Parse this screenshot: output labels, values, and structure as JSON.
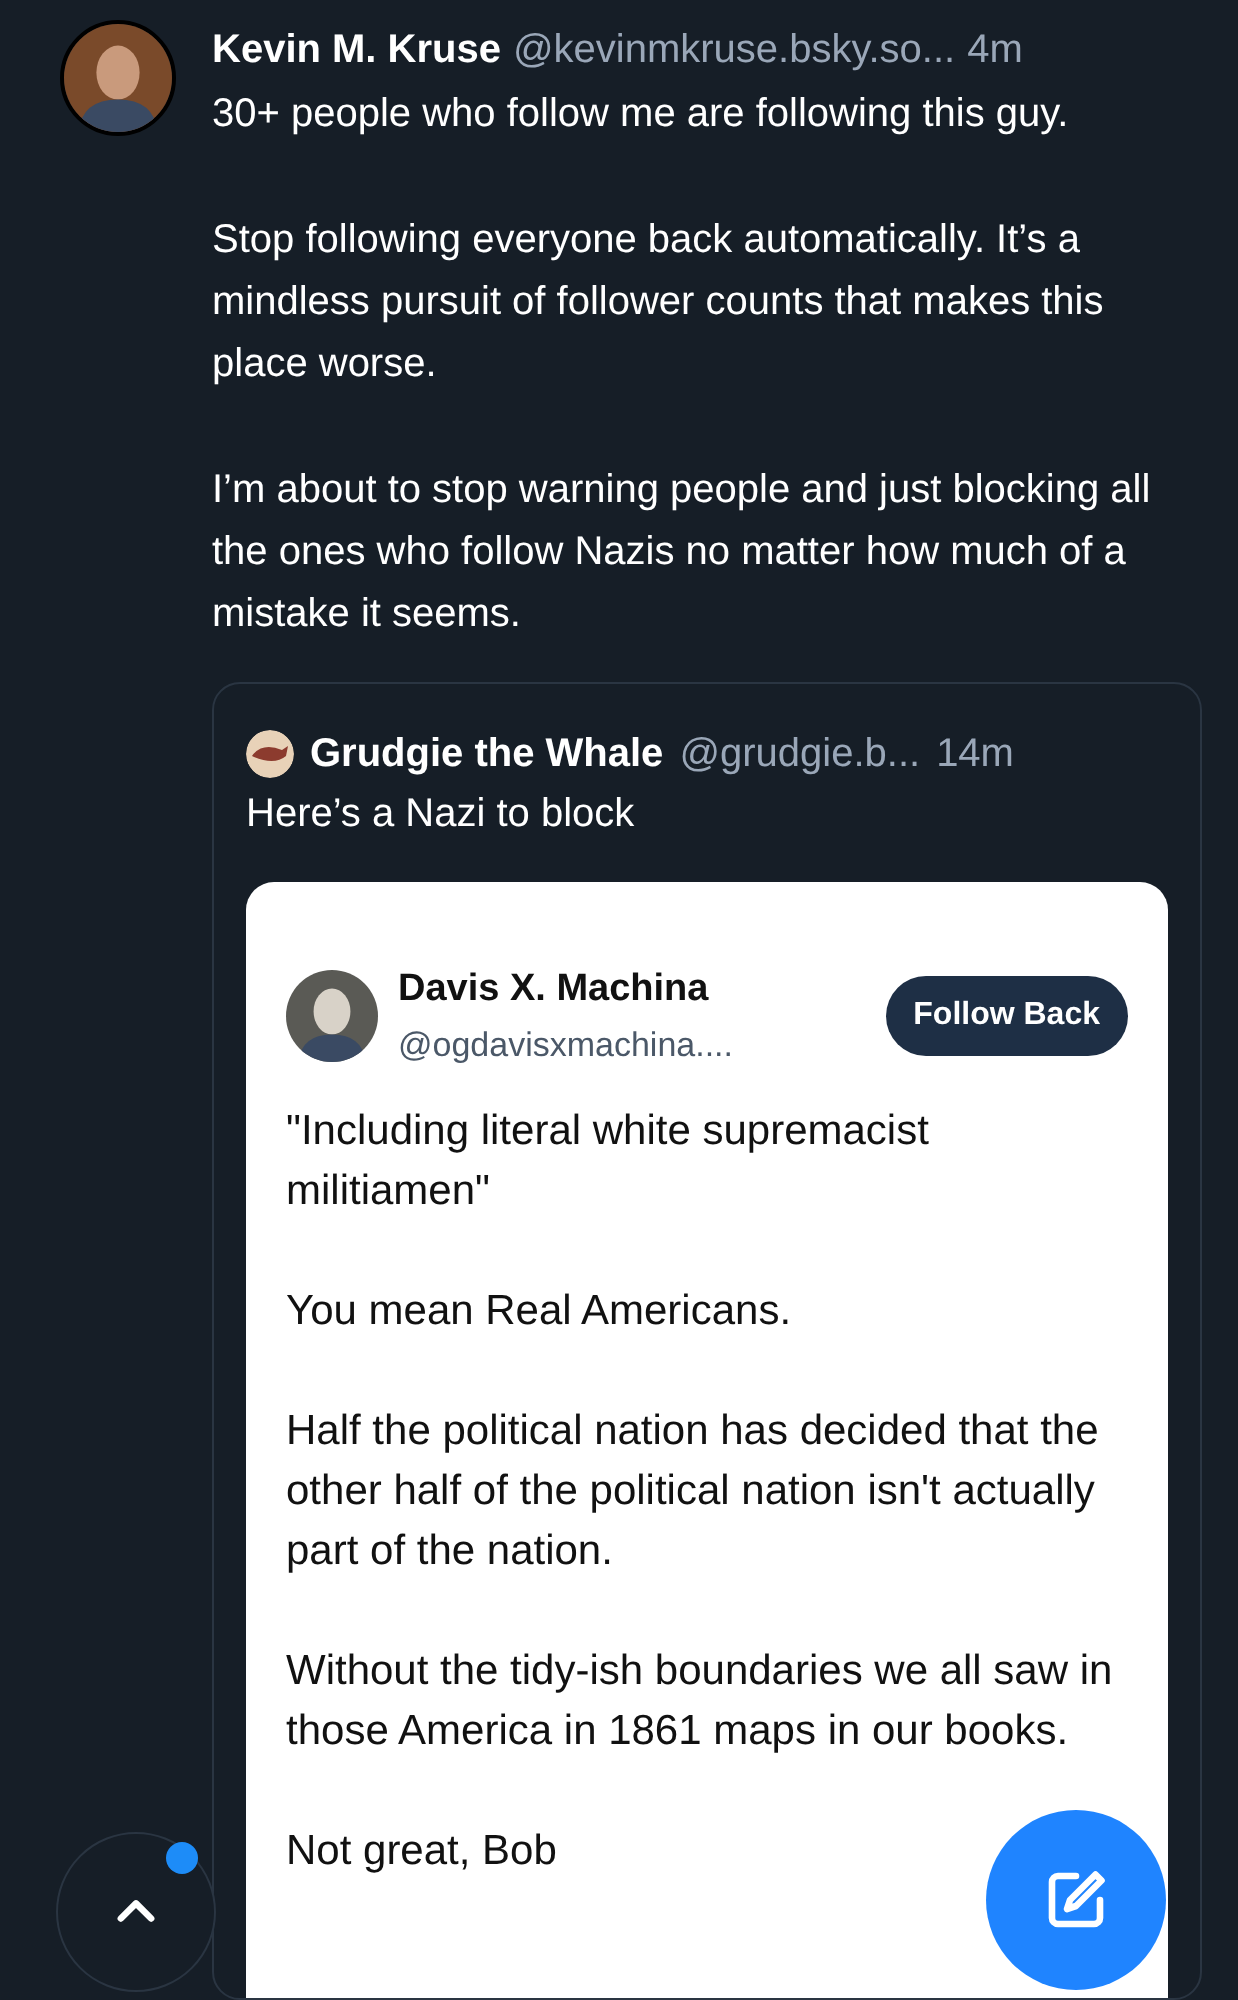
{
  "post": {
    "author": "Kevin M. Kruse",
    "handle": "@kevinmkruse.bsky.so...",
    "time": "4m",
    "paragraphs": [
      "30+ people who follow me are following this guy.",
      "Stop following everyone back automatically. It’s a mindless pursuit of follower counts that makes this place worse.",
      "I’m about to stop warning people and just blocking all the ones who follow Nazis no matter how much of a mistake it seems."
    ]
  },
  "quote": {
    "author": "Grudgie the Whale",
    "handle": "@grudgie.b...",
    "time": "14m",
    "text": "Here’s a Nazi to block",
    "screenshot": {
      "author": "Davis X. Machina",
      "handle": "@ogdavisxmachina....",
      "button": "Follow Back",
      "paragraphs": [
        "\"Including literal white supremacist militiamen\"",
        "You mean Real Americans.",
        "Half the political nation has decided that the other half of the political nation isn't actually part of the nation.",
        "Without the tidy-ish boundaries we all saw in those America in 1861 maps in our books.",
        "Not great, Bob"
      ]
    }
  },
  "scroll_top": {
    "unread": true
  }
}
